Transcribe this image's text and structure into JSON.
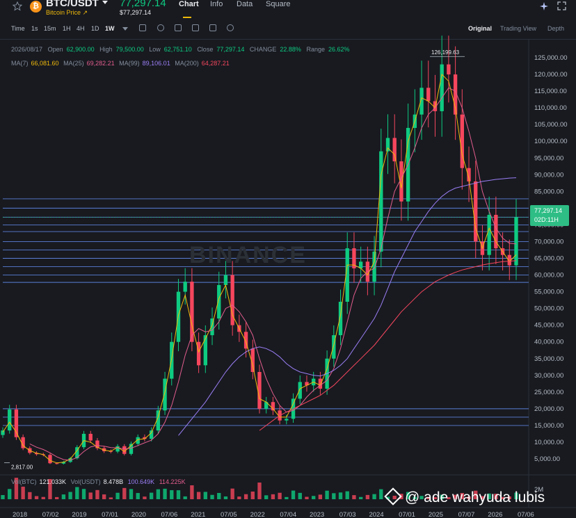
{
  "header": {
    "pair": "BTC/USDT",
    "subtitle": "Bitcoin Price",
    "last_price": "77,297.14",
    "last_price_usd": "$77,297.14",
    "tabs": [
      "Chart",
      "Info",
      "Data",
      "Square"
    ],
    "active_tab": "Chart"
  },
  "toolbar": {
    "timeframes": [
      "Time",
      "1s",
      "15m",
      "1H",
      "4H",
      "1D",
      "1W"
    ],
    "active_timeframe": "1W",
    "views": [
      "Original",
      "Trading View",
      "Depth"
    ],
    "active_view": "Original"
  },
  "ohlc": {
    "date": "2026/08/17",
    "open_label": "Open",
    "open": "62,900.00",
    "high_label": "High",
    "high": "79,500.00",
    "low_label": "Low",
    "low": "62,751.10",
    "close_label": "Close",
    "close": "77,297.14",
    "change_label": "CHANGE",
    "change": "22.88%",
    "range_label": "Range",
    "range": "26.62%"
  },
  "ma": [
    {
      "label": "MA(7)",
      "value": "66,081.60",
      "color": "#f0b90b"
    },
    {
      "label": "MA(25)",
      "value": "69,282.21",
      "color": "#e35d8c"
    },
    {
      "label": "MA(99)",
      "value": "89,106.01",
      "color": "#9c7ef5"
    },
    {
      "label": "MA(200)",
      "value": "64,287.21",
      "color": "#f6465d"
    }
  ],
  "volume": {
    "label": "Vol(BTC)",
    "btc": "121.033K",
    "usdt_label": "Vol(USDT)",
    "usdt": "8.478B",
    "ma1": "100.649K",
    "ma1_color": "#9c7ef5",
    "ma2": "114.225K",
    "ma2_color": "#e35d8c",
    "axis_label": "2M"
  },
  "price_tag": {
    "price": "77,297.14",
    "countdown": "02D:11H",
    "color": "#2ebd85"
  },
  "watermark": "BINANCE",
  "signature": "@ ade wahyuda lubis",
  "chart_data": {
    "type": "candlestick",
    "y_axis_ticks": [
      "125,000.00",
      "120,000.00",
      "115,000.00",
      "110,000.00",
      "105,000.00",
      "100,000.00",
      "95,000.00",
      "90,000.00",
      "85,000.00",
      "80,000.00",
      "75,000.00",
      "70,000.00",
      "65,000.00",
      "60,000.00",
      "55,000.00",
      "50,000.00",
      "45,000.00",
      "40,000.00",
      "35,000.00",
      "30,000.00",
      "25,000.00",
      "20,000.00",
      "15,000.00",
      "10,000.00",
      "5,000.00"
    ],
    "x_axis_ticks": [
      "2018",
      "07/02",
      "2019",
      "07/01",
      "2020",
      "07/06",
      "2021",
      "07/05",
      "2022",
      "07/04",
      "2023",
      "07/03",
      "2024",
      "07/01",
      "2025",
      "07/07",
      "2026",
      "07/06"
    ],
    "ylim": [
      0,
      127000
    ],
    "high_label": "126,199.63",
    "low_label": "2,817.00",
    "horizontal_levels": [
      82800,
      80000,
      77300,
      75000,
      73000,
      70000,
      67500,
      65000,
      62500,
      60000,
      57800,
      20000,
      17500,
      15000
    ],
    "series": [
      {
        "name": "BTC/USDT",
        "close": [
          13500,
          19800,
          11500,
          8200,
          6800,
          6400,
          6200,
          3700,
          3600,
          4100,
          5200,
          8500,
          12500,
          10500,
          8200,
          7300,
          7200,
          8800,
          6500,
          9500,
          11500,
          11000,
          13500,
          19500,
          29000,
          40000,
          55000,
          58000,
          40000,
          33000,
          42000,
          47000,
          57000,
          60000,
          45000,
          43000,
          38000,
          31000,
          20000,
          22000,
          19500,
          16500,
          17000,
          23000,
          28000,
          27000,
          29000,
          26000,
          35000,
          42000,
          52000,
          68000,
          62000,
          64000,
          58000,
          67000,
          97000,
          101000,
          94000,
          82000,
          104000,
          108000,
          116000,
          112000,
          109000,
          123000,
          120000,
          108000,
          92000,
          88000,
          70000,
          66000,
          78000,
          68000,
          66000,
          62900,
          77297
        ]
      }
    ],
    "ma_series": [
      {
        "name": "MA(7)",
        "values": [
          13000,
          16000,
          13000,
          9000,
          7500,
          6700,
          6300,
          4500,
          3800,
          4000,
          5000,
          7500,
          10500,
          10000,
          8500,
          7600,
          7300,
          8500,
          7200,
          9000,
          10800,
          11000,
          12800,
          17500,
          25000,
          35000,
          48000,
          54000,
          45000,
          37000,
          41000,
          45000,
          53000,
          57000,
          48000,
          44000,
          40000,
          33000,
          23000,
          22000,
          20000,
          17500,
          17500,
          21500,
          26000,
          27000,
          28000,
          27000,
          32000,
          39000,
          48000,
          63000,
          63000,
          62000,
          60000,
          64000,
          90000,
          98000,
          96000,
          86000,
          100000,
          106000,
          113000,
          112000,
          110000,
          120000,
          118000,
          110000,
          96000,
          89000,
          74000,
          68000,
          74000,
          70000,
          67000,
          64000,
          66081
        ]
      },
      {
        "name": "MA(25)",
        "values": [
          null,
          null,
          null,
          null,
          9500,
          8500,
          7800,
          6800,
          5600,
          4800,
          4600,
          5400,
          7200,
          8600,
          9000,
          8800,
          8400,
          8300,
          8000,
          8200,
          9000,
          9800,
          10600,
          12500,
          16000,
          21000,
          28000,
          36000,
          42000,
          44000,
          43000,
          43500,
          46000,
          50000,
          51000,
          49000,
          46000,
          42000,
          35000,
          29000,
          24500,
          21000,
          19000,
          19500,
          21000,
          23500,
          25500,
          27000,
          28500,
          32000,
          38000,
          46000,
          54000,
          59000,
          61000,
          62000,
          68000,
          77000,
          85000,
          89000,
          93000,
          98000,
          104000,
          108000,
          110000,
          113000,
          116000,
          115000,
          110000,
          103000,
          95000,
          85000,
          79000,
          74000,
          71000,
          69500,
          69282
        ]
      },
      {
        "name": "MA(99)",
        "values": [
          null,
          null,
          null,
          null,
          null,
          null,
          null,
          null,
          null,
          null,
          null,
          null,
          null,
          null,
          null,
          null,
          null,
          null,
          null,
          null,
          null,
          null,
          null,
          null,
          null,
          null,
          12000,
          14500,
          17000,
          19500,
          22000,
          25000,
          28000,
          31000,
          33500,
          35500,
          37000,
          38000,
          38500,
          38000,
          37000,
          35500,
          33500,
          32000,
          31000,
          30500,
          30000,
          29800,
          30500,
          31500,
          33000,
          35000,
          38000,
          41000,
          44000,
          47000,
          51000,
          56000,
          61000,
          65000,
          69000,
          73000,
          76000,
          79000,
          81500,
          83500,
          85000,
          86000,
          86500,
          87000,
          87500,
          88000,
          88300,
          88600,
          88800,
          89000,
          89106
        ]
      },
      {
        "name": "MA(200)",
        "values": [
          null,
          null,
          null,
          null,
          null,
          null,
          null,
          null,
          null,
          null,
          null,
          null,
          null,
          null,
          null,
          null,
          null,
          null,
          null,
          null,
          null,
          null,
          null,
          null,
          null,
          null,
          null,
          null,
          null,
          null,
          null,
          null,
          null,
          null,
          null,
          null,
          null,
          null,
          13500,
          15000,
          16500,
          18000,
          19000,
          20000,
          21000,
          22000,
          23000,
          24000,
          25500,
          27000,
          29000,
          31000,
          33000,
          35000,
          37000,
          39000,
          41500,
          44000,
          46500,
          49000,
          51000,
          53000,
          55000,
          56500,
          58000,
          59000,
          60000,
          60800,
          61500,
          62000,
          62500,
          63000,
          63400,
          63700,
          64000,
          64150,
          64287
        ]
      }
    ]
  }
}
